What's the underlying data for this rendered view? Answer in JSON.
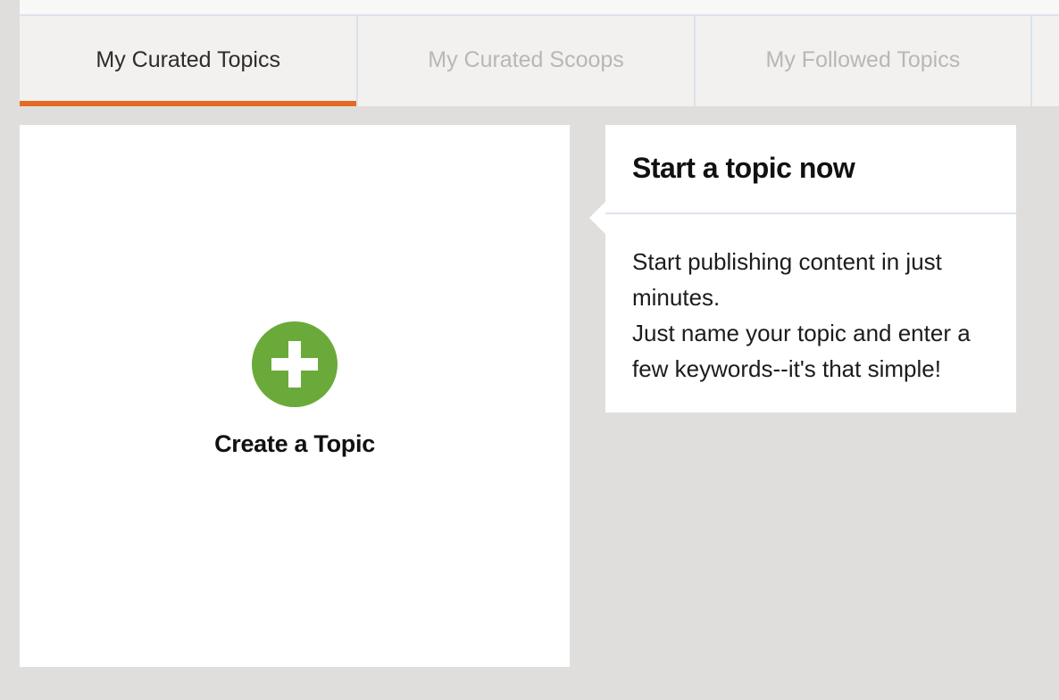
{
  "tabs": [
    {
      "label": "My Curated Topics",
      "active": true
    },
    {
      "label": "My Curated Scoops",
      "active": false
    },
    {
      "label": "My Followed Topics",
      "active": false
    }
  ],
  "create_card": {
    "label": "Create a Topic",
    "icon": "plus-circle-icon"
  },
  "tip": {
    "title": "Start a topic now",
    "line1": "Start publishing content in just minutes.",
    "line2": "Just name your topic and enter a few keywords--it's that simple!"
  },
  "colors": {
    "accent": "#e46a23",
    "create_green": "#6aaa3a",
    "background": "#dfdedc"
  }
}
